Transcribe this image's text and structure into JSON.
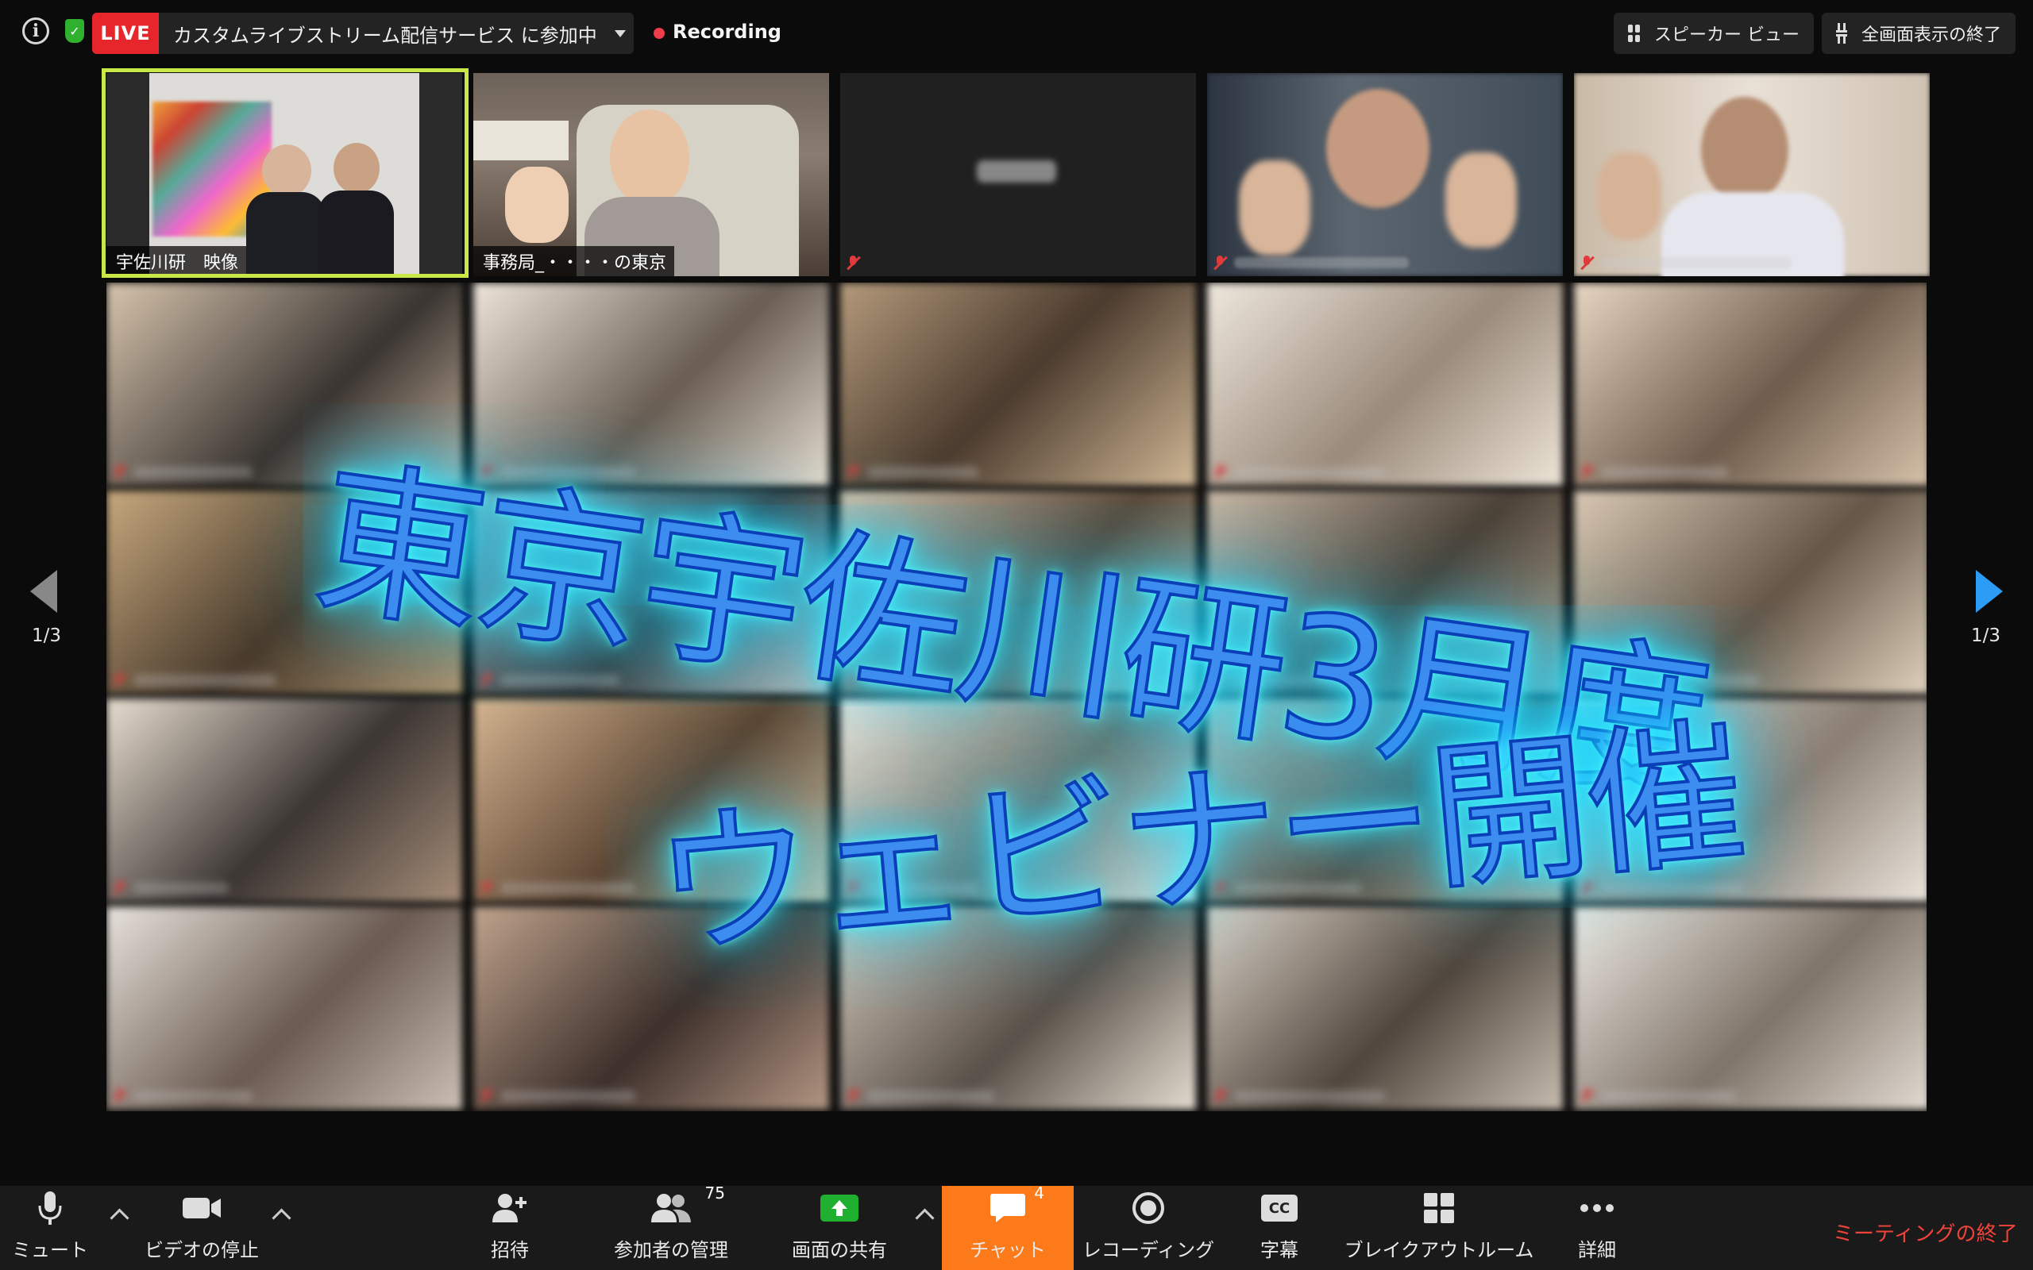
{
  "topbar": {
    "live_badge": "LIVE",
    "live_stream_text": "カスタムライブストリーム配信サービス に参加中",
    "recording_label": "Recording",
    "speaker_view_label": "スピーカー ビュー",
    "exit_fullscreen_label": "全画面表示の終了",
    "colors": {
      "live": "#e6262b",
      "recording_dot": "#ee3c4a",
      "active_speaker_border": "#c8e84a"
    }
  },
  "gallery": {
    "top_row": [
      {
        "name": "宇佐川研　映像",
        "muted": false,
        "active": true
      },
      {
        "name": "事務局_・・・・の東京",
        "muted": false,
        "active": false
      },
      {
        "name": "",
        "muted": true,
        "active": false
      },
      {
        "name": "",
        "muted": true,
        "active": false
      },
      {
        "name": "",
        "muted": true,
        "active": false
      }
    ],
    "page_left": "1/3",
    "page_right": "1/3"
  },
  "overlay": {
    "title_line1": "東京宇佐川研3月度",
    "title_line2": "ウェビナー開催",
    "glow_color": "#2df",
    "text_color": "#3d8cf0"
  },
  "toolbar": {
    "mute_label": "ミュート",
    "video_label": "ビデオの停止",
    "invite_label": "招待",
    "participants_label": "参加者の管理",
    "participants_count": "75",
    "share_label": "画面の共有",
    "chat_label": "チャット",
    "chat_count": "4",
    "recording_label": "レコーディング",
    "captions_label": "字幕",
    "cc_text": "CC",
    "breakout_label": "ブレイクアウトルーム",
    "more_label": "詳細",
    "end_label": "ミーティングの終了",
    "colors": {
      "chat_bg": "#fd7a1b",
      "share_green": "#1fb02f",
      "end_red": "#f0443b"
    }
  },
  "icons": [
    "info-icon",
    "encryption-shield-icon",
    "gallery-grid-icon",
    "exit-fullscreen-icon",
    "microphone-icon",
    "video-camera-icon",
    "add-user-icon",
    "participants-icon",
    "share-screen-icon",
    "chat-bubble-icon",
    "record-icon",
    "closed-caption-icon",
    "breakout-rooms-icon",
    "more-dots-icon",
    "previous-page-icon",
    "next-page-icon"
  ]
}
